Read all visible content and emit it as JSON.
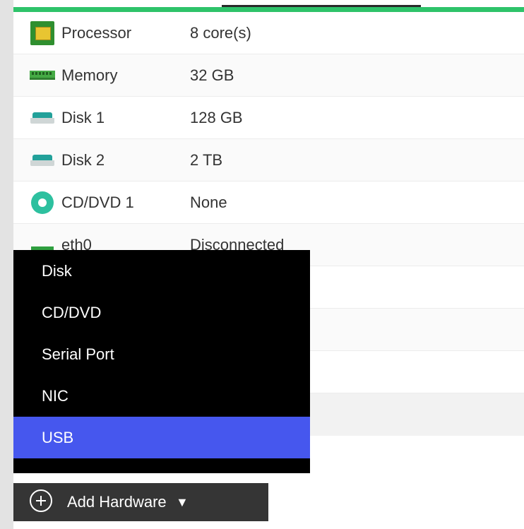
{
  "hardware_rows": [
    {
      "name": "Processor",
      "value": "8 core(s)",
      "icon": "cpu-icon"
    },
    {
      "name": "Memory",
      "value": "32 GB",
      "icon": "memory-icon"
    },
    {
      "name": "Disk 1",
      "value": "128 GB",
      "icon": "disk-icon"
    },
    {
      "name": "Disk 2",
      "value": "2 TB",
      "icon": "disk-icon"
    },
    {
      "name": "CD/DVD 1",
      "value": "None",
      "icon": "cd-icon"
    },
    {
      "name": "eth0",
      "value": "Disconnected",
      "icon": "network-icon"
    }
  ],
  "add_menu": {
    "items": [
      "Disk",
      "CD/DVD",
      "Serial Port",
      "NIC",
      "USB"
    ],
    "highlighted": "USB"
  },
  "add_button": {
    "label": "Add Hardware",
    "caret": "▼",
    "icon": "plus-circle-icon"
  },
  "colors": {
    "accent_green": "#2ec36a",
    "menu_highlight": "#4657ee",
    "menu_background": "#000000"
  }
}
